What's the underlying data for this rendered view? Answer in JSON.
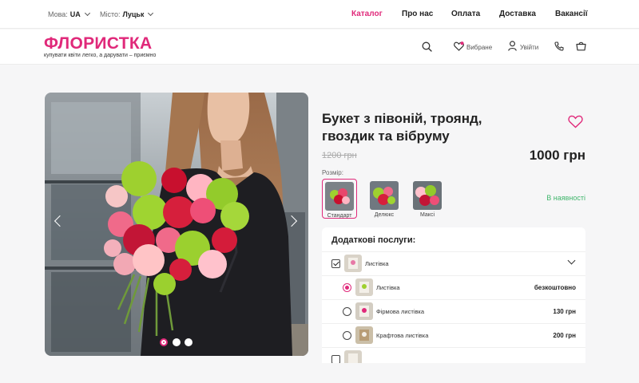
{
  "topbar": {
    "language_label": "Мова:",
    "language_value": "UA",
    "city_label": "Місто:",
    "city_value": "Луцьк",
    "nav": [
      "Каталог",
      "Про нас",
      "Оплата",
      "Доставка",
      "Вакансії"
    ],
    "active_nav": "Каталог"
  },
  "header": {
    "logo": "ФЛОРИСТКА",
    "slogan": "купувати квіти легко, а дарувати – приємно",
    "favorites_label": "Вибране",
    "login_label": "Увійти",
    "icons": [
      "search-icon",
      "heart-icon",
      "user-icon",
      "phone-icon",
      "cart-icon"
    ]
  },
  "gallery": {
    "slides": 3,
    "active_slide": 1
  },
  "product": {
    "title": "Букет з півоній, троянд, гвоздик та вібруму",
    "old_price": "1200 грн",
    "price": "1000 грн",
    "size_label": "Розмір:",
    "sizes": [
      "Стандарт",
      "Делюкс",
      "Максі"
    ],
    "selected_size": "Стандарт",
    "stock": "В наявності"
  },
  "extras": {
    "title": "Додаткові послуги:",
    "group_label": "Листівка",
    "group_checked": true,
    "options": [
      {
        "label": "Листівка",
        "price": "безкоштовно",
        "selected": true
      },
      {
        "label": "Фірмова листівка",
        "price": "130 грн",
        "selected": false
      },
      {
        "label": "Крафтова листівка",
        "price": "200 грн",
        "selected": false
      }
    ]
  },
  "colors": {
    "accent": "#e0297a",
    "stock": "#3fb56b",
    "background": "#f6f6f7"
  }
}
